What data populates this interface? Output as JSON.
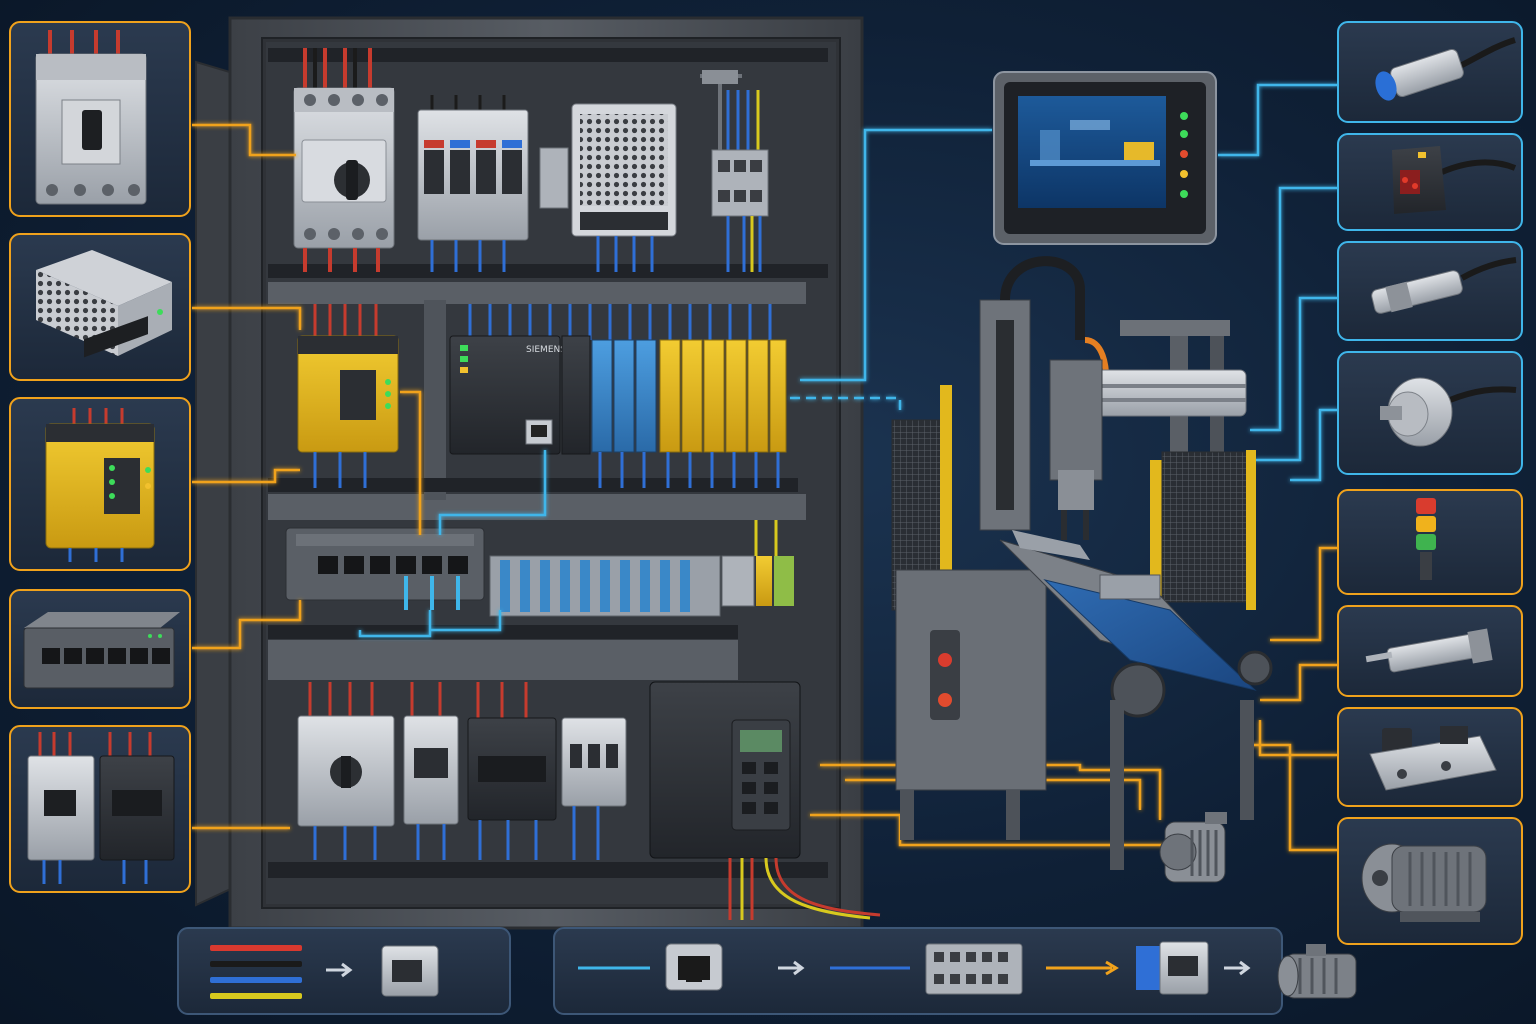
{
  "title": "",
  "colors": {
    "background": "#0f2036",
    "power_accent": "#f0a21c",
    "network_accent": "#3fb6ea",
    "cabinet": "#4a4e54",
    "safety_yellow": "#e2b81d",
    "io_blue": "#3a88c8"
  },
  "cabinet": {
    "psu_label": "",
    "plc_label": "",
    "module_brand": "SIEMENS"
  },
  "left_components": [
    {
      "name": "main-circuit-breaker",
      "icon": "breaker-icon"
    },
    {
      "name": "power-supply",
      "icon": "psu-icon"
    },
    {
      "name": "safety-relay",
      "icon": "safety-relay-icon"
    },
    {
      "name": "network-switch",
      "icon": "switch-icon"
    },
    {
      "name": "contactors-overloads",
      "icon": "contactor-icon"
    }
  ],
  "right_components": [
    {
      "name": "inductive-proximity-sensor",
      "icon": "proximity-sensor-icon",
      "group": "network"
    },
    {
      "name": "photoelectric-sensor",
      "icon": "photo-sensor-icon",
      "group": "network"
    },
    {
      "name": "cylindrical-sensor",
      "icon": "sensor-icon",
      "group": "network"
    },
    {
      "name": "rotary-encoder",
      "icon": "encoder-icon",
      "group": "network"
    },
    {
      "name": "stack-light",
      "icon": "stack-light-icon",
      "group": "power"
    },
    {
      "name": "pneumatic-cylinder",
      "icon": "cylinder-icon",
      "group": "power"
    },
    {
      "name": "solenoid-valve",
      "icon": "valve-icon",
      "group": "power"
    },
    {
      "name": "electric-motor",
      "icon": "motor-icon",
      "group": "power"
    }
  ],
  "hmi": {
    "icon": "hmi-screen-icon"
  },
  "legend": {
    "wire_colors": [
      "#d9392f",
      "#1a1a1a",
      "#2f6fd6",
      "#d8c91e"
    ],
    "flow": [
      "network-cable",
      "rj45-port",
      "fieldbus-cable",
      "terminal-block",
      "power-cable",
      "contactor",
      "motor"
    ]
  }
}
